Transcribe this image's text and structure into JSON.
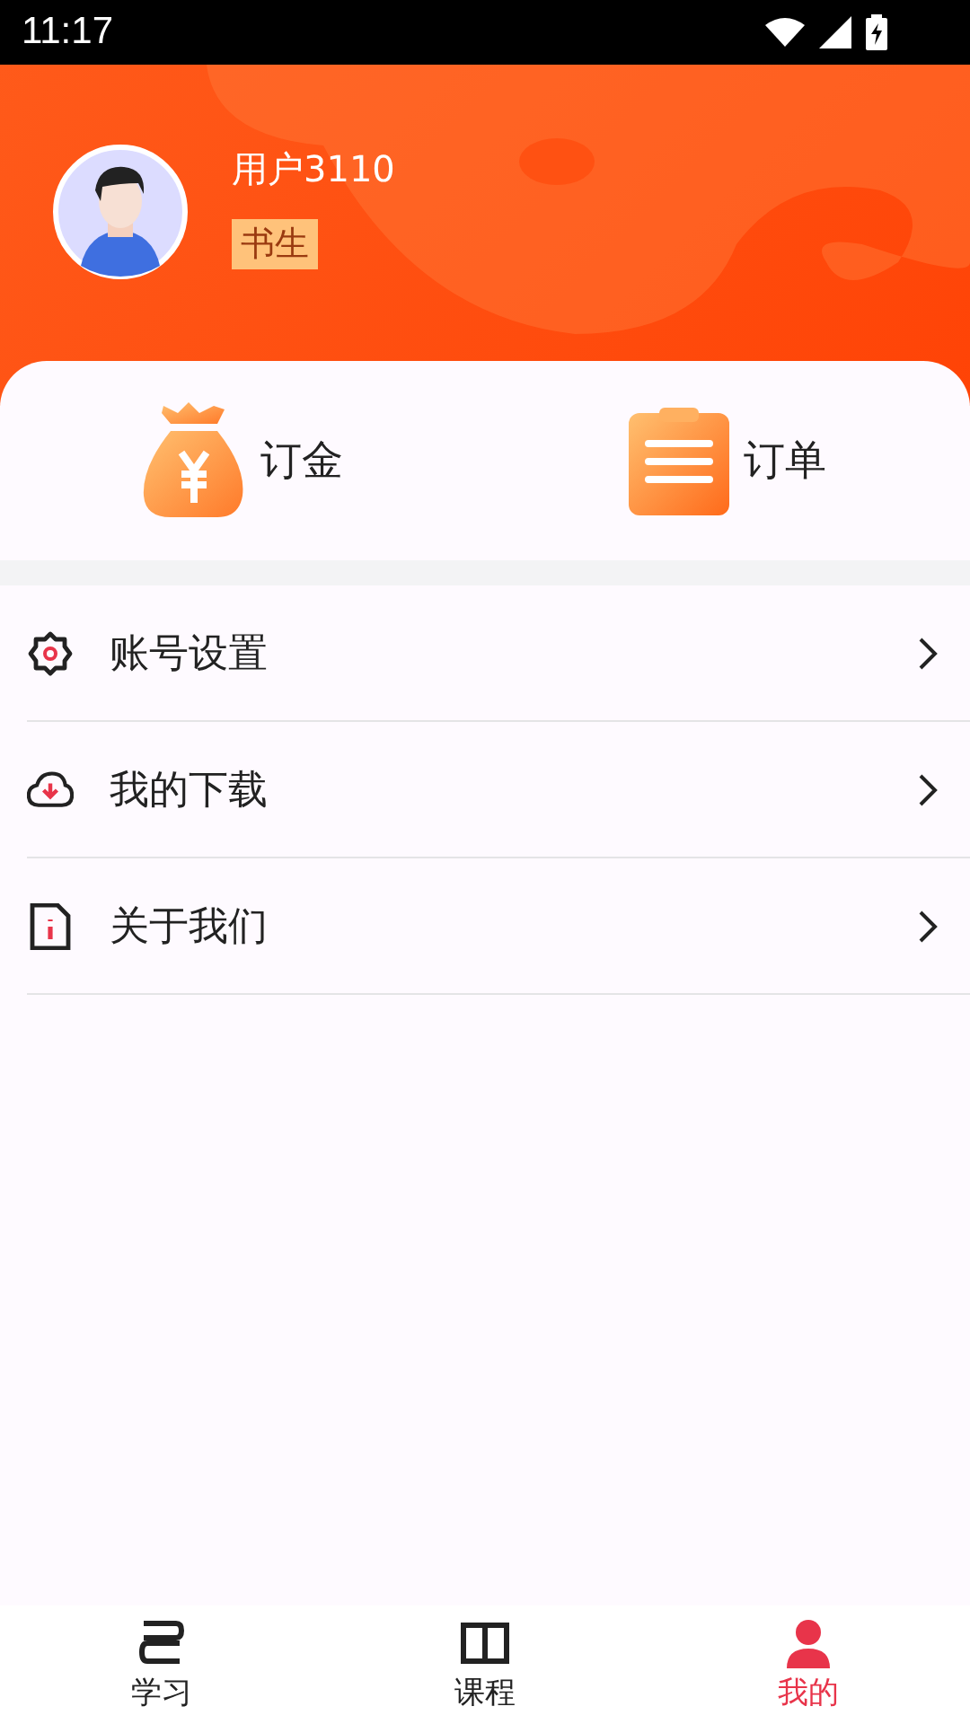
{
  "status_bar": {
    "time": "11:17"
  },
  "profile": {
    "name": "用户3110",
    "badge": "书生"
  },
  "shortcuts": [
    {
      "kind": "deposit",
      "label": "订金"
    },
    {
      "kind": "orders",
      "label": "订单"
    }
  ],
  "menu": [
    {
      "kind": "settings",
      "label": "账号设置"
    },
    {
      "kind": "download",
      "label": "我的下载"
    },
    {
      "kind": "about",
      "label": "关于我们"
    }
  ],
  "tabs": [
    {
      "kind": "study",
      "label": "学习",
      "selected": false
    },
    {
      "kind": "course",
      "label": "课程",
      "selected": false
    },
    {
      "kind": "me",
      "label": "我的",
      "selected": true
    }
  ]
}
